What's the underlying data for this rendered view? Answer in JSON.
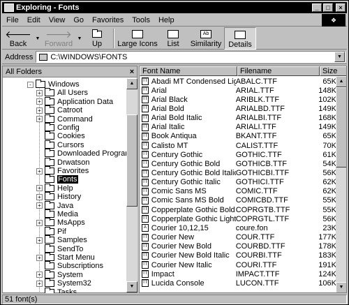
{
  "window": {
    "title": "Exploring - Fonts",
    "min": "_",
    "max": "□",
    "close": "×"
  },
  "menu": {
    "file": "File",
    "edit": "Edit",
    "view": "View",
    "go": "Go",
    "favorites": "Favorites",
    "tools": "Tools",
    "help": "Help"
  },
  "toolbar": {
    "back": "Back",
    "forward": "Forward",
    "up": "Up",
    "large_icons": "Large Icons",
    "list": "List",
    "similarity": "Similarity",
    "details": "Details"
  },
  "address": {
    "label": "Address",
    "value": "C:\\WINDOWS\\FONTS"
  },
  "left_pane": {
    "title": "All Folders",
    "close": "×",
    "items": [
      {
        "label": "Windows",
        "level": 0,
        "expander": "-"
      },
      {
        "label": "All Users",
        "level": 1,
        "expander": "+"
      },
      {
        "label": "Application Data",
        "level": 1,
        "expander": "+"
      },
      {
        "label": "Catroot",
        "level": 1,
        "expander": "+"
      },
      {
        "label": "Command",
        "level": 1,
        "expander": "+"
      },
      {
        "label": "Config",
        "level": 1,
        "expander": ""
      },
      {
        "label": "Cookies",
        "level": 1,
        "expander": ""
      },
      {
        "label": "Cursors",
        "level": 1,
        "expander": ""
      },
      {
        "label": "Downloaded Program Files",
        "level": 1,
        "expander": ""
      },
      {
        "label": "Drwatson",
        "level": 1,
        "expander": ""
      },
      {
        "label": "Favorites",
        "level": 1,
        "expander": "+"
      },
      {
        "label": "Fonts",
        "level": 1,
        "expander": "",
        "selected": true
      },
      {
        "label": "Help",
        "level": 1,
        "expander": "+"
      },
      {
        "label": "History",
        "level": 1,
        "expander": "+"
      },
      {
        "label": "Java",
        "level": 1,
        "expander": "+"
      },
      {
        "label": "Media",
        "level": 1,
        "expander": ""
      },
      {
        "label": "MsApps",
        "level": 1,
        "expander": "+"
      },
      {
        "label": "Pif",
        "level": 1,
        "expander": ""
      },
      {
        "label": "Samples",
        "level": 1,
        "expander": "+"
      },
      {
        "label": "SendTo",
        "level": 1,
        "expander": ""
      },
      {
        "label": "Start Menu",
        "level": 1,
        "expander": "+"
      },
      {
        "label": "Subscriptions",
        "level": 1,
        "expander": ""
      },
      {
        "label": "System",
        "level": 1,
        "expander": "+"
      },
      {
        "label": "System32",
        "level": 1,
        "expander": "+"
      },
      {
        "label": "Tasks",
        "level": 1,
        "expander": ""
      }
    ]
  },
  "file_list": {
    "columns": {
      "name": "Font Name",
      "file": "Filename",
      "size": "Size"
    },
    "rows": [
      {
        "name": "Abadi MT Condensed Light",
        "file": "ABALC.TTF",
        "size": "65K",
        "type": "TT"
      },
      {
        "name": "Arial",
        "file": "ARIAL.TTF",
        "size": "148K",
        "type": "TT"
      },
      {
        "name": "Arial Black",
        "file": "ARIBLK.TTF",
        "size": "102K",
        "type": "TT"
      },
      {
        "name": "Arial Bold",
        "file": "ARIALBD.TTF",
        "size": "149K",
        "type": "TT"
      },
      {
        "name": "Arial Bold Italic",
        "file": "ARIALBI.TTF",
        "size": "168K",
        "type": "TT"
      },
      {
        "name": "Arial Italic",
        "file": "ARIALI.TTF",
        "size": "149K",
        "type": "TT"
      },
      {
        "name": "Book Antiqua",
        "file": "BKANT.TTF",
        "size": "65K",
        "type": "TT"
      },
      {
        "name": "Calisto MT",
        "file": "CALIST.TTF",
        "size": "70K",
        "type": "TT"
      },
      {
        "name": "Century Gothic",
        "file": "GOTHIC.TTF",
        "size": "61K",
        "type": "TT"
      },
      {
        "name": "Century Gothic Bold",
        "file": "GOTHICB.TTF",
        "size": "54K",
        "type": "TT"
      },
      {
        "name": "Century Gothic Bold Italic",
        "file": "GOTHICBI.TTF",
        "size": "56K",
        "type": "TT"
      },
      {
        "name": "Century Gothic Italic",
        "file": "GOTHICI.TTF",
        "size": "62K",
        "type": "TT"
      },
      {
        "name": "Comic Sans MS",
        "file": "COMIC.TTF",
        "size": "62K",
        "type": "TT"
      },
      {
        "name": "Comic Sans MS Bold",
        "file": "COMICBD.TTF",
        "size": "55K",
        "type": "TT"
      },
      {
        "name": "Copperplate Gothic Bold",
        "file": "COPRGTB.TTF",
        "size": "55K",
        "type": "TT"
      },
      {
        "name": "Copperplate Gothic Light",
        "file": "COPRGTL.TTF",
        "size": "56K",
        "type": "TT"
      },
      {
        "name": "Courier 10,12,15",
        "file": "coure.fon",
        "size": "23K",
        "type": "A"
      },
      {
        "name": "Courier New",
        "file": "COUR.TTF",
        "size": "177K",
        "type": "TT"
      },
      {
        "name": "Courier New Bold",
        "file": "COURBD.TTF",
        "size": "178K",
        "type": "TT"
      },
      {
        "name": "Courier New Bold Italic",
        "file": "COURBI.TTF",
        "size": "183K",
        "type": "TT"
      },
      {
        "name": "Courier New Italic",
        "file": "COURI.TTF",
        "size": "191K",
        "type": "TT"
      },
      {
        "name": "Impact",
        "file": "IMPACT.TTF",
        "size": "124K",
        "type": "TT"
      },
      {
        "name": "Lucida Console",
        "file": "LUCON.TTF",
        "size": "106K",
        "type": "TT"
      }
    ]
  },
  "status": {
    "text": "51 font(s)"
  }
}
